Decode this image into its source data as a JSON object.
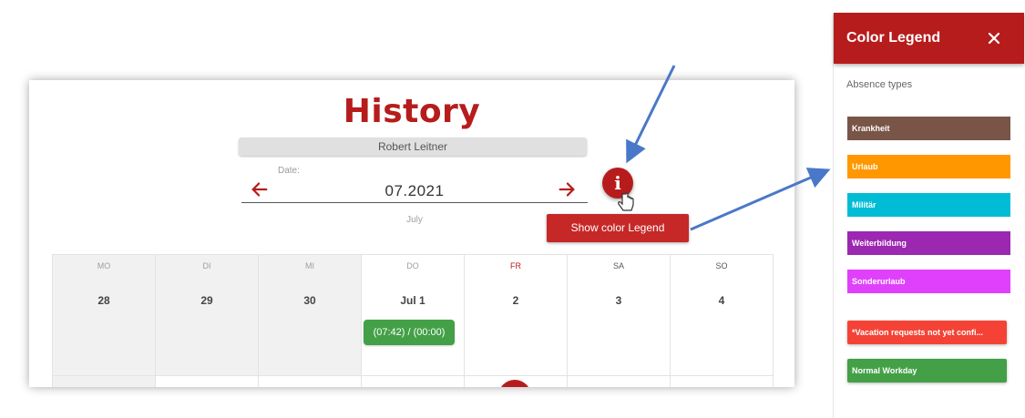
{
  "history": {
    "title": "History",
    "employee": "Robert Leitner",
    "date_label": "Date:",
    "date_value": "07.2021",
    "month_hint": "July",
    "info_icon": "info-icon",
    "tooltip": "Show color Legend"
  },
  "calendar": {
    "weekdays": [
      "MO",
      "DI",
      "MI",
      "DO",
      "FR",
      "SA",
      "SO"
    ],
    "days": [
      "28",
      "29",
      "30",
      "Jul 1",
      "2",
      "3",
      "4"
    ],
    "entry": "(07:42) / (00:00)"
  },
  "legend": {
    "title": "Color Legend",
    "close_icon": "close-icon",
    "subtitle": "Absence types",
    "items": [
      {
        "label": "Krankheit",
        "color": "#795548"
      },
      {
        "label": "Urlaub",
        "color": "#ff9800"
      },
      {
        "label": "Militär",
        "color": "#00bcd4"
      },
      {
        "label": "Weiterbildung",
        "color": "#9c27b0"
      },
      {
        "label": "Sonderurlaub",
        "color": "#e040fb"
      },
      {
        "label": "*Vacation requests not yet confi...",
        "color": "#f44336"
      },
      {
        "label": "Normal Workday",
        "color": "#43a047"
      }
    ]
  },
  "colors": {
    "brand_red": "#b71c1c",
    "annotation_arrow": "#4a78c8"
  }
}
